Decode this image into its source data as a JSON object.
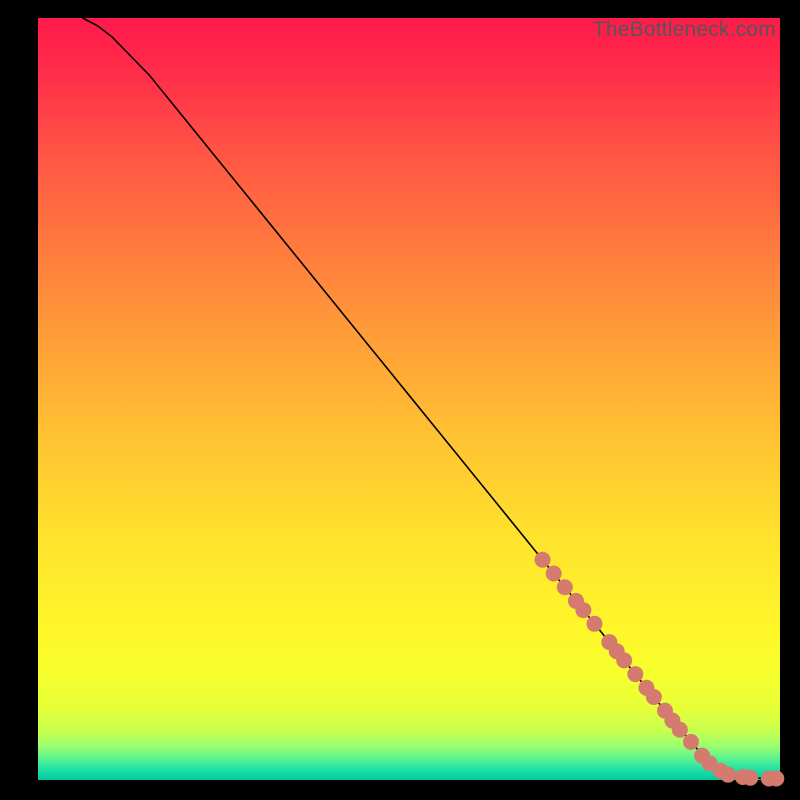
{
  "watermark": "TheBottleneck.com",
  "chart_data": {
    "type": "line",
    "title": "",
    "xlabel": "",
    "ylabel": "",
    "xlim": [
      0,
      100
    ],
    "ylim": [
      0,
      100
    ],
    "grid": false,
    "line": {
      "x": [
        6,
        8,
        10,
        12,
        15,
        20,
        25,
        30,
        35,
        40,
        45,
        50,
        55,
        60,
        65,
        70,
        75,
        80,
        85,
        88,
        90,
        92,
        94,
        96,
        98,
        100
      ],
      "y": [
        100,
        99,
        97.5,
        95.5,
        92.5,
        86.5,
        80.5,
        74.5,
        68.5,
        62.5,
        56.5,
        50.5,
        44.5,
        38.5,
        32.5,
        26.5,
        20.5,
        14.5,
        8.5,
        5.0,
        2.8,
        1.4,
        0.6,
        0.3,
        0.2,
        0.2
      ]
    },
    "markers": {
      "color": "#d57a6f",
      "radius_px": 8,
      "points": [
        {
          "x": 68,
          "y": 28.9
        },
        {
          "x": 69.5,
          "y": 27.1
        },
        {
          "x": 71,
          "y": 25.3
        },
        {
          "x": 72.5,
          "y": 23.5
        },
        {
          "x": 73.5,
          "y": 22.3
        },
        {
          "x": 75,
          "y": 20.5
        },
        {
          "x": 77,
          "y": 18.1
        },
        {
          "x": 78,
          "y": 16.9
        },
        {
          "x": 79,
          "y": 15.7
        },
        {
          "x": 80.5,
          "y": 13.9
        },
        {
          "x": 82,
          "y": 12.1
        },
        {
          "x": 83,
          "y": 10.9
        },
        {
          "x": 84.5,
          "y": 9.1
        },
        {
          "x": 85.5,
          "y": 7.8
        },
        {
          "x": 86.5,
          "y": 6.6
        },
        {
          "x": 88,
          "y": 5.0
        },
        {
          "x": 89.5,
          "y": 3.2
        },
        {
          "x": 90.5,
          "y": 2.2
        },
        {
          "x": 92,
          "y": 1.2
        },
        {
          "x": 93,
          "y": 0.7
        },
        {
          "x": 95,
          "y": 0.4
        },
        {
          "x": 96,
          "y": 0.3
        },
        {
          "x": 98.5,
          "y": 0.2
        },
        {
          "x": 99.5,
          "y": 0.2
        }
      ]
    },
    "gradient_stops": [
      {
        "offset": 0.0,
        "color": "#ff1a4b"
      },
      {
        "offset": 0.07,
        "color": "#ff2c4a"
      },
      {
        "offset": 0.18,
        "color": "#ff5644"
      },
      {
        "offset": 0.3,
        "color": "#ff7a3e"
      },
      {
        "offset": 0.42,
        "color": "#ff9e38"
      },
      {
        "offset": 0.55,
        "color": "#ffc232"
      },
      {
        "offset": 0.68,
        "color": "#ffe22d"
      },
      {
        "offset": 0.8,
        "color": "#fff62a"
      },
      {
        "offset": 0.86,
        "color": "#f7ff2d"
      },
      {
        "offset": 0.905,
        "color": "#e7ff38"
      },
      {
        "offset": 0.935,
        "color": "#c8ff4e"
      },
      {
        "offset": 0.955,
        "color": "#9cff6e"
      },
      {
        "offset": 0.97,
        "color": "#63f58e"
      },
      {
        "offset": 0.982,
        "color": "#2fe6a0"
      },
      {
        "offset": 0.992,
        "color": "#0fd7a6"
      },
      {
        "offset": 1.0,
        "color": "#03c99a"
      }
    ]
  }
}
